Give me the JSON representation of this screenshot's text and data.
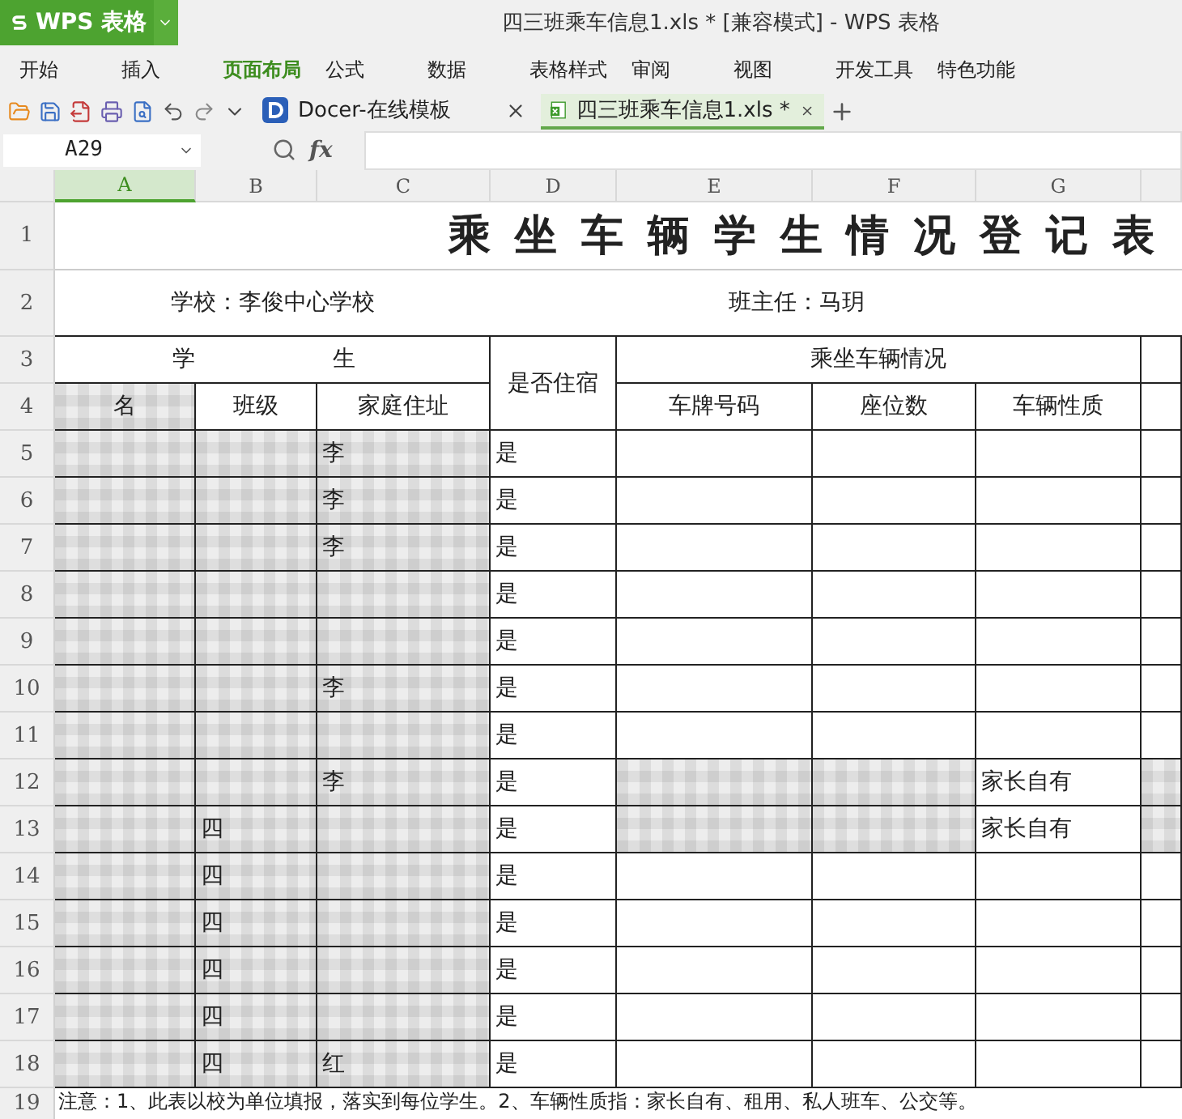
{
  "app": {
    "button": "WPS 表格",
    "title": "四三班乘车信息1.xls * [兼容模式] - WPS 表格"
  },
  "menu": [
    {
      "label": "开始",
      "selected": false
    },
    {
      "label": "插入",
      "selected": false
    },
    {
      "label": "页面布局",
      "selected": true
    },
    {
      "label": "公式",
      "selected": false
    },
    {
      "label": "数据",
      "selected": false
    },
    {
      "label": "表格样式",
      "selected": false
    },
    {
      "label": "审阅",
      "selected": false
    },
    {
      "label": "视图",
      "selected": false
    },
    {
      "label": "开发工具",
      "selected": false
    },
    {
      "label": "特色功能",
      "selected": false
    }
  ],
  "doc_tabs": [
    {
      "label": "Docer-在线模板",
      "kind": "docer",
      "selected": false
    },
    {
      "label": "四三班乘车信息1.xls *",
      "kind": "sheet",
      "selected": true
    }
  ],
  "formula_bar": {
    "cell_ref": "A29",
    "fx": "fx"
  },
  "columns": [
    {
      "label": "A",
      "selected": true
    },
    {
      "label": "B",
      "selected": false
    },
    {
      "label": "C",
      "selected": false
    },
    {
      "label": "D",
      "selected": false
    },
    {
      "label": "E",
      "selected": false
    },
    {
      "label": "F",
      "selected": false
    },
    {
      "label": "G",
      "selected": false
    }
  ],
  "sheet": {
    "title": "乘坐车辆学生情况登记表",
    "school": "学校：李俊中心学校",
    "teacher": "班主任：马玥",
    "group_student": [
      "学",
      "生"
    ],
    "boarding": "是否住宿",
    "group_vehicle": "乘坐车辆情况",
    "header_rows": [
      "1",
      "2",
      "3",
      "4"
    ],
    "headers": [
      "名",
      "班级",
      "家庭住址",
      "车牌号码",
      "座位数",
      "车辆性质"
    ],
    "header_blurred": [
      true,
      false,
      false,
      false,
      false,
      false
    ]
  },
  "rows": [
    {
      "header": "5",
      "cells": [
        "",
        "",
        "李",
        "是",
        "",
        "",
        "",
        ""
      ],
      "blurred": [
        true,
        true,
        true,
        false,
        false,
        false,
        false,
        false
      ]
    },
    {
      "header": "6",
      "cells": [
        "",
        "",
        "李",
        "是",
        "",
        "",
        "",
        ""
      ],
      "blurred": [
        true,
        true,
        true,
        false,
        false,
        false,
        false,
        false
      ]
    },
    {
      "header": "7",
      "cells": [
        "",
        "",
        "李",
        "是",
        "",
        "",
        "",
        ""
      ],
      "blurred": [
        true,
        true,
        true,
        false,
        false,
        false,
        false,
        false
      ]
    },
    {
      "header": "8",
      "cells": [
        "",
        "",
        "",
        "是",
        "",
        "",
        "",
        ""
      ],
      "blurred": [
        true,
        true,
        true,
        false,
        false,
        false,
        false,
        false
      ]
    },
    {
      "header": "9",
      "cells": [
        "",
        "",
        "",
        "是",
        "",
        "",
        "",
        ""
      ],
      "blurred": [
        true,
        true,
        true,
        false,
        false,
        false,
        false,
        false
      ]
    },
    {
      "header": "10",
      "cells": [
        "",
        "",
        "李",
        "是",
        "",
        "",
        "",
        ""
      ],
      "blurred": [
        true,
        true,
        true,
        false,
        false,
        false,
        false,
        false
      ]
    },
    {
      "header": "11",
      "cells": [
        "",
        "",
        "",
        "是",
        "",
        "",
        "",
        ""
      ],
      "blurred": [
        true,
        true,
        true,
        false,
        false,
        false,
        false,
        false
      ]
    },
    {
      "header": "12",
      "cells": [
        "",
        "",
        "李",
        "是",
        "",
        "",
        "家长自有",
        ""
      ],
      "blurred": [
        true,
        true,
        true,
        false,
        true,
        true,
        false,
        true
      ]
    },
    {
      "header": "13",
      "cells": [
        "",
        "四",
        "",
        "是",
        "",
        "",
        "家长自有",
        ""
      ],
      "blurred": [
        true,
        true,
        true,
        false,
        true,
        true,
        false,
        true
      ]
    },
    {
      "header": "14",
      "cells": [
        "",
        "四",
        "",
        "是",
        "",
        "",
        "",
        ""
      ],
      "blurred": [
        true,
        true,
        true,
        false,
        false,
        false,
        false,
        false
      ]
    },
    {
      "header": "15",
      "cells": [
        "",
        "四",
        "",
        "是",
        "",
        "",
        "",
        ""
      ],
      "blurred": [
        true,
        true,
        true,
        false,
        false,
        false,
        false,
        false
      ]
    },
    {
      "header": "16",
      "cells": [
        "",
        "四",
        "",
        "是",
        "",
        "",
        "",
        ""
      ],
      "blurred": [
        true,
        true,
        true,
        false,
        false,
        false,
        false,
        false
      ]
    },
    {
      "header": "17",
      "cells": [
        "",
        "四",
        "",
        "是",
        "",
        "",
        "",
        ""
      ],
      "blurred": [
        true,
        true,
        true,
        false,
        false,
        false,
        false,
        false
      ]
    },
    {
      "header": "18",
      "cells": [
        "",
        "四",
        "红",
        "是",
        "",
        "",
        "",
        ""
      ],
      "blurred": [
        true,
        true,
        true,
        false,
        false,
        false,
        false,
        false
      ]
    }
  ],
  "note": {
    "header": "19",
    "text": "注意：1、此表以校为单位填报，落实到每位学生。2、车辆性质指：家长自有、租用、私人班车、公交等。"
  }
}
